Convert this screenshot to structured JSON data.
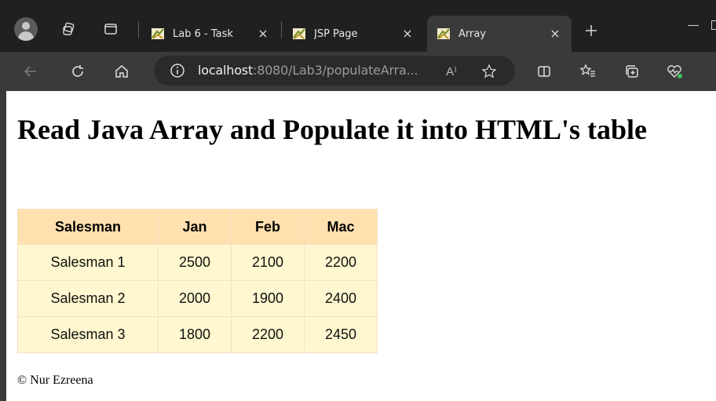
{
  "browser": {
    "tabs": [
      {
        "title": "Lab 6 - Task",
        "active": false
      },
      {
        "title": "JSP Page",
        "active": false
      },
      {
        "title": "Array",
        "active": true
      }
    ],
    "url_host": "localhost",
    "url_path": ":8080/Lab3/populateArra...",
    "read_aloud_label": "A⁾"
  },
  "page": {
    "heading": "Read Java Array and Populate it into HTML's table",
    "table": {
      "headers": [
        "Salesman",
        "Jan",
        "Feb",
        "Mac"
      ],
      "rows": [
        [
          "Salesman 1",
          "2500",
          "2100",
          "2200"
        ],
        [
          "Salesman 2",
          "2000",
          "1900",
          "2400"
        ],
        [
          "Salesman 3",
          "1800",
          "2200",
          "2450"
        ]
      ]
    },
    "footer": "© Nur Ezreena"
  },
  "colors": {
    "header_bg": "#ffe1b0",
    "cell_bg": "#fff7cf",
    "chrome_bg": "#202020",
    "toolbar_bg": "#3a3a3a"
  }
}
